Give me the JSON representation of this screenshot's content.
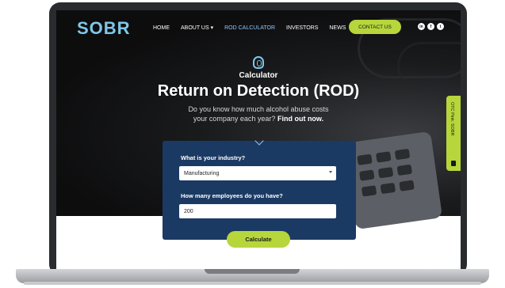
{
  "brand": {
    "logo": "SOBR"
  },
  "nav": {
    "items": [
      "HOME",
      "ABOUT US ▾",
      "ROD CALCULATOR",
      "INVESTORS",
      "NEWS"
    ],
    "active_index": 2,
    "contact_label": "CONTACT US"
  },
  "socials": [
    "linkedin-icon",
    "facebook-icon",
    "twitter-icon"
  ],
  "hero": {
    "eyebrow": "Calculator",
    "title": "Return on Detection (ROD)",
    "subtitle_line1": "Do you know how much alcohol abuse costs",
    "subtitle_line2_prefix": "your company each year?",
    "subtitle_cta": "Find out now."
  },
  "form": {
    "industry_label": "What is your industry?",
    "industry_value": "Manufacturing",
    "employees_label": "How many employees do you have?",
    "employees_value": "200",
    "submit_label": "Calculate"
  },
  "side_tab": {
    "label": "OTC Pink: SOBR"
  },
  "colors": {
    "accent_green": "#b6d63b",
    "brand_blue": "#7fc7e8",
    "card_blue": "#1b3a63"
  }
}
